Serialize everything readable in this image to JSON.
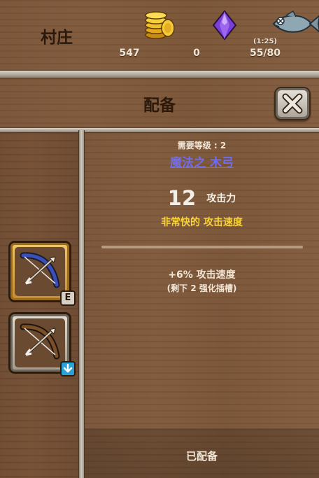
{
  "topbar": {
    "location": "村庄",
    "gold": "547",
    "gems": "0",
    "fish_timer": "(1:25)",
    "fish": "55/80"
  },
  "panel": {
    "title": "配备"
  },
  "item": {
    "requirement": "需要等级 : 2",
    "name": "魔法之 木弓",
    "attack_value": "12",
    "attack_label": "攻击力",
    "speed_text": "非常快的 攻击速度",
    "bonus": "+6% 攻击速度",
    "slots_left": "(剩下 2 强化插槽)",
    "status": "已配备"
  },
  "sidebar": {
    "badge_equipped": "E"
  },
  "colors": {
    "item_name": "#6f6cf2",
    "speed_text": "#f7d23c",
    "wood": "#7a5538"
  }
}
